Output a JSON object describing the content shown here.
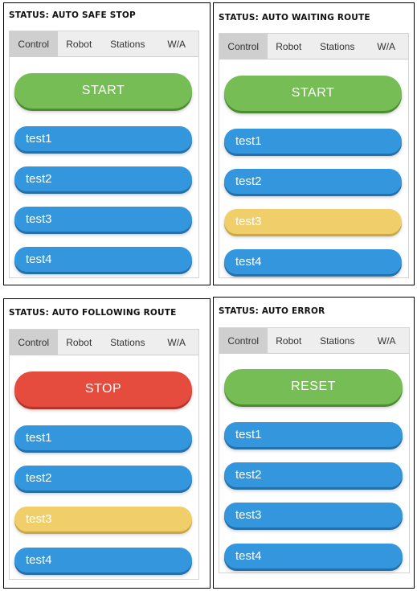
{
  "tabs": [
    "Control",
    "Robot",
    "Stations",
    "W/A"
  ],
  "colors": {
    "start_green": "#77bd55",
    "stop_red": "#e54c3d",
    "test_blue": "#3497dd",
    "test_highlight_yellow": "#f0cf6b",
    "tab_bar": "#eeeeee",
    "tab_active": "#cfcfcf"
  },
  "panels": [
    {
      "status": "STATUS: AUTO SAFE STOP",
      "active_tab": "Control",
      "main_button": {
        "label": "START",
        "color": "green"
      },
      "tests": [
        {
          "label": "test1",
          "color": "blue"
        },
        {
          "label": "test2",
          "color": "blue"
        },
        {
          "label": "test3",
          "color": "blue"
        },
        {
          "label": "test4",
          "color": "blue"
        }
      ]
    },
    {
      "status": "STATUS: AUTO WAITING ROUTE",
      "active_tab": "Control",
      "main_button": {
        "label": "START",
        "color": "green"
      },
      "tests": [
        {
          "label": "test1",
          "color": "blue"
        },
        {
          "label": "test2",
          "color": "blue"
        },
        {
          "label": "test3",
          "color": "yellow"
        },
        {
          "label": "test4",
          "color": "blue"
        }
      ]
    },
    {
      "status": "STATUS: AUTO FOLLOWING ROUTE",
      "active_tab": "Control",
      "main_button": {
        "label": "STOP",
        "color": "red"
      },
      "tests": [
        {
          "label": "test1",
          "color": "blue"
        },
        {
          "label": "test2",
          "color": "blue"
        },
        {
          "label": "test3",
          "color": "yellow"
        },
        {
          "label": "test4",
          "color": "blue"
        }
      ]
    },
    {
      "status": "STATUS: AUTO ERROR",
      "active_tab": "Control",
      "main_button": {
        "label": "RESET",
        "color": "green"
      },
      "tests": [
        {
          "label": "test1",
          "color": "blue"
        },
        {
          "label": "test2",
          "color": "blue"
        },
        {
          "label": "test3",
          "color": "blue"
        },
        {
          "label": "test4",
          "color": "blue"
        }
      ]
    }
  ]
}
